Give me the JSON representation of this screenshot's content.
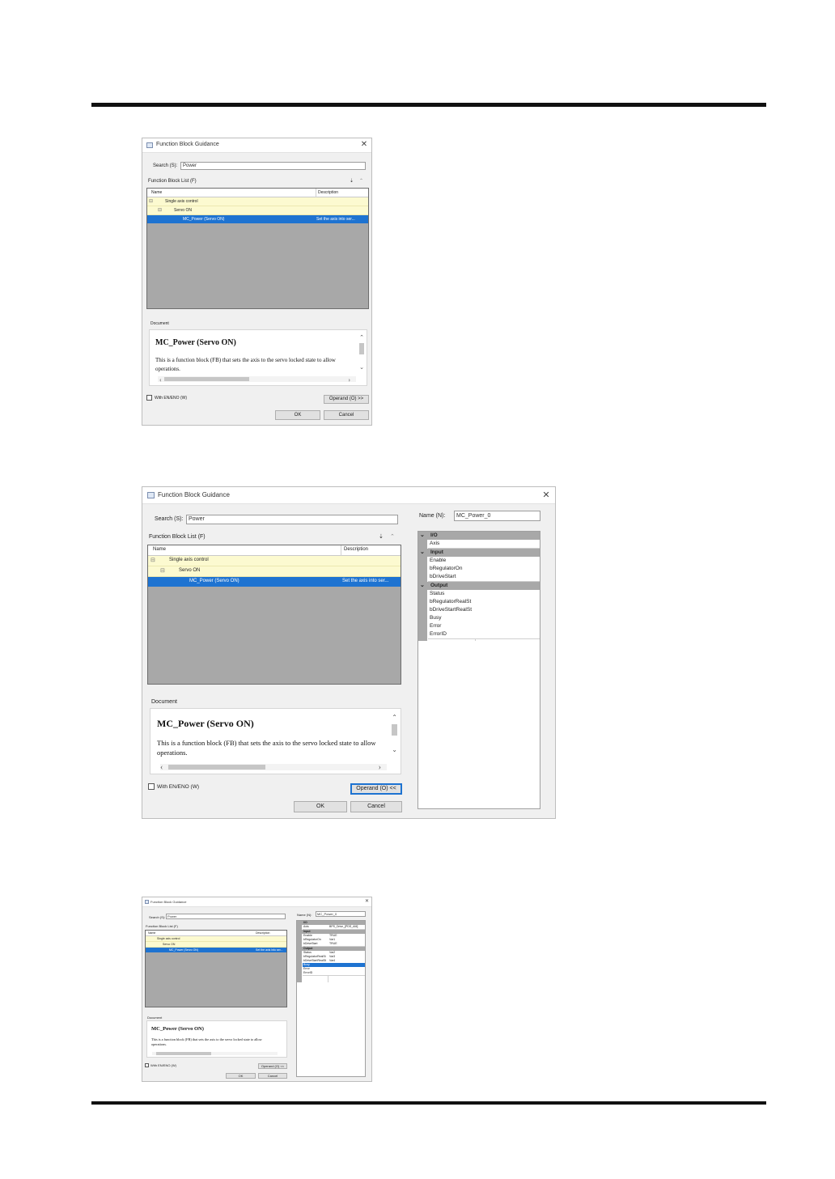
{
  "dialog": {
    "title": "Function Block Guidance",
    "search_label": "Search (S):",
    "search_value": "Power",
    "list_label": "Function Block List (F)",
    "col_name": "Name",
    "col_description": "Description",
    "rows": [
      {
        "name": "Single axis control",
        "description": ""
      },
      {
        "name": "Servo ON",
        "description": ""
      },
      {
        "name": "MC_Power (Servo ON)",
        "description": "Set the axis into ser..."
      }
    ],
    "document_label": "Document",
    "doc_title": "MC_Power (Servo ON)",
    "doc_text": "This is a function block (FB) that sets the axis to the servo locked state to allow operations.",
    "en_eno_label": "With EN/ENO (W)",
    "operand_expand": "Operand (O) >>",
    "operand_collapse": "Operand (O) <<",
    "ok": "OK",
    "cancel": "Cancel",
    "name_label": "Name (N):",
    "name_value": "MC_Power_0"
  },
  "operands": {
    "io_header": "I/O",
    "io": [
      {
        "name": "Axis",
        "value": "BPS_Drive_[PDS_AM]"
      }
    ],
    "input_header": "Input",
    "input": [
      {
        "name": "Enable",
        "value": "TRUE"
      },
      {
        "name": "bRegulatorOn",
        "value": "Var1"
      },
      {
        "name": "bDriveStart",
        "value": "TRUE"
      }
    ],
    "output_header": "Output",
    "output": [
      {
        "name": "Status",
        "value": "Var2"
      },
      {
        "name": "bRegulatorRealSt",
        "value": "Var3"
      },
      {
        "name": "bDriveStartRealSt",
        "value": "Var4"
      },
      {
        "name": "Busy",
        "value": ""
      },
      {
        "name": "Error",
        "value": ""
      },
      {
        "name": "ErrorID",
        "value": ""
      }
    ]
  }
}
